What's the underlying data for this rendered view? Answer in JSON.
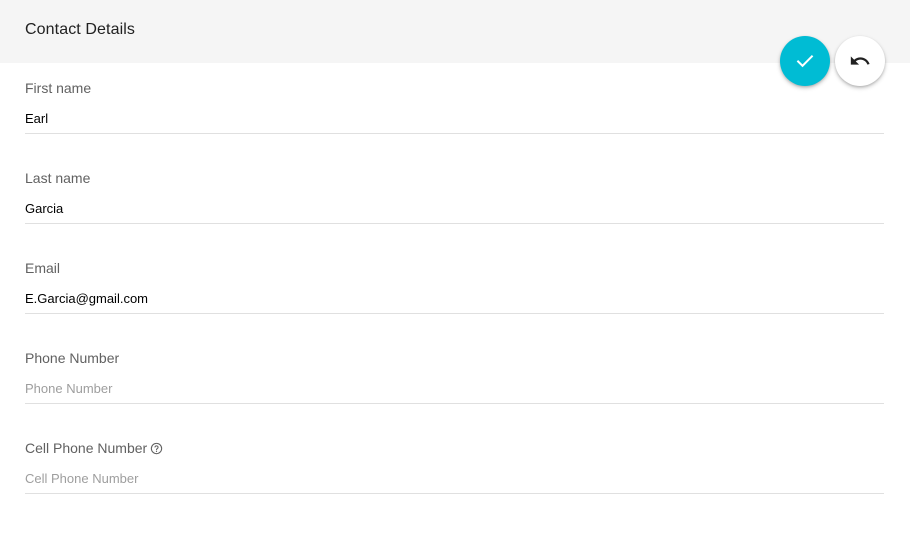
{
  "header": {
    "title": "Contact Details"
  },
  "actions": {
    "save_icon": "check-icon",
    "undo_icon": "undo-icon"
  },
  "colors": {
    "accent": "#00bcd4",
    "header_bg": "#f5f5f5"
  },
  "form": {
    "fields": [
      {
        "label": "First name",
        "value": "Earl",
        "placeholder": ""
      },
      {
        "label": "Last name",
        "value": "Garcia",
        "placeholder": ""
      },
      {
        "label": "Email",
        "value": "E.Garcia@gmail.com",
        "placeholder": ""
      },
      {
        "label": "Phone Number",
        "value": "",
        "placeholder": "Phone Number"
      },
      {
        "label": "Cell Phone Number",
        "value": "",
        "placeholder": "Cell Phone Number",
        "help_icon": "help-circle-icon"
      }
    ]
  }
}
